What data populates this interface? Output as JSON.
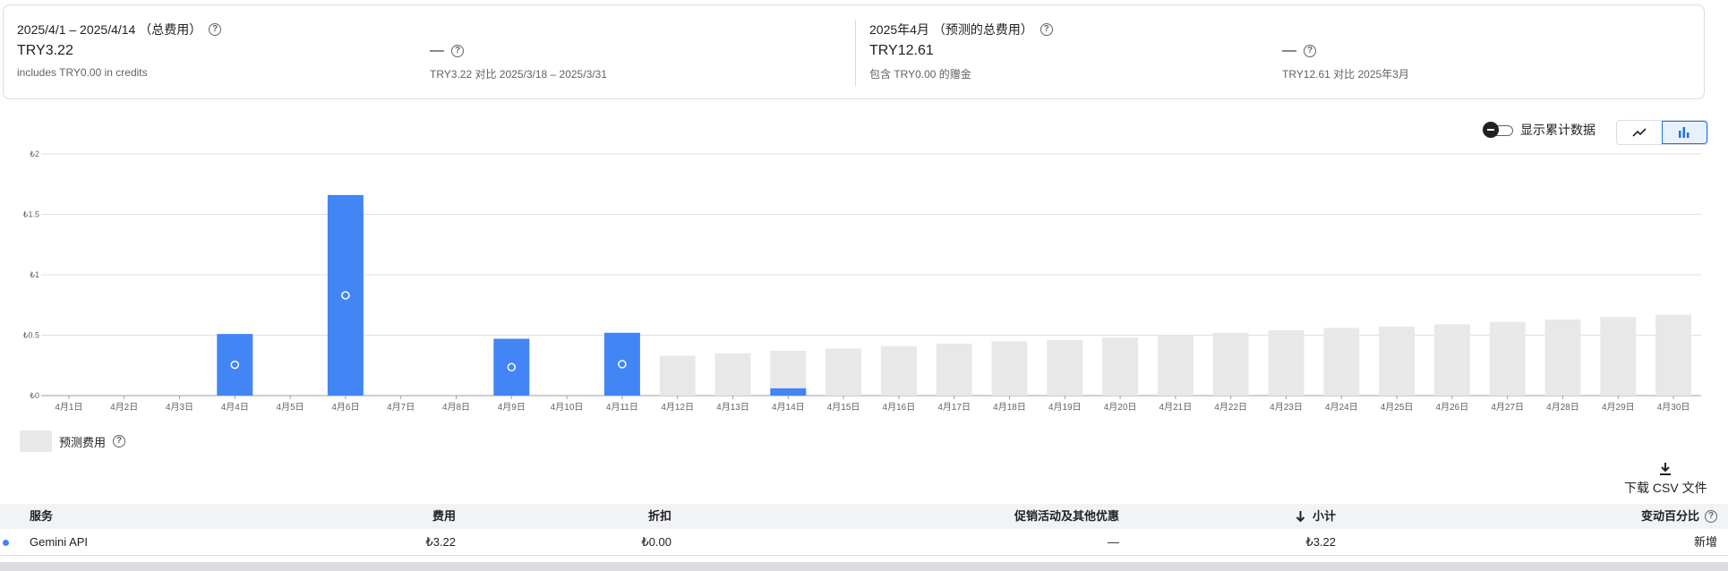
{
  "summary": {
    "left": {
      "title": "2025/4/1 – 2025/4/14 （总费用）",
      "value": "TRY3.22",
      "sub": "includes TRY0.00 in credits",
      "delta": "—",
      "delta_sub": "TRY3.22 对比 2025/3/18 – 2025/3/31"
    },
    "right": {
      "title": "2025年4月 （预测的总费用）",
      "value": "TRY12.61",
      "sub": "包含 TRY0.00 的赠金",
      "delta": "—",
      "delta_sub": "TRY12.61 对比 2025年3月"
    }
  },
  "controls": {
    "cumulative_label": "显示累计数据",
    "line_chart_icon": "line-chart-icon",
    "bar_chart_icon": "bar-chart-icon"
  },
  "chart_data": {
    "type": "bar",
    "categories": [
      "4月1日",
      "4月2日",
      "4月3日",
      "4月4日",
      "4月5日",
      "4月6日",
      "4月7日",
      "4月8日",
      "4月9日",
      "4月10日",
      "4月11日",
      "4月12日",
      "4月13日",
      "4月14日",
      "4月15日",
      "4月16日",
      "4月17日",
      "4月18日",
      "4月19日",
      "4月20日",
      "4月21日",
      "4月22日",
      "4月23日",
      "4月24日",
      "4月25日",
      "4月26日",
      "4月27日",
      "4月28日",
      "4月29日",
      "4月30日"
    ],
    "series": [
      {
        "name": "Gemini API",
        "values": [
          0,
          0,
          0,
          0.51,
          0,
          1.66,
          0,
          0,
          0.47,
          0,
          0.52,
          0,
          0,
          0.06,
          0,
          0,
          0,
          0,
          0,
          0,
          0,
          0,
          0,
          0,
          0,
          0,
          0,
          0,
          0,
          0
        ]
      },
      {
        "name": "预测费用",
        "values": [
          0,
          0,
          0,
          0,
          0,
          0,
          0,
          0,
          0,
          0,
          0,
          0.33,
          0.35,
          0.37,
          0.39,
          0.41,
          0.43,
          0.45,
          0.46,
          0.48,
          0.5,
          0.52,
          0.54,
          0.56,
          0.57,
          0.59,
          0.61,
          0.63,
          0.65,
          0.67
        ]
      }
    ],
    "yticks": [
      "₺0",
      "₺0.5",
      "₺1",
      "₺1.5",
      "₺2"
    ],
    "ylim": [
      0,
      2
    ],
    "colors": {
      "actual": "#4285f4",
      "forecast": "#e8e8e8"
    },
    "grid": true
  },
  "legend": {
    "forecast_label": "预测费用"
  },
  "download": {
    "label": "下载 CSV 文件"
  },
  "table": {
    "headers": {
      "service": "服务",
      "cost": "费用",
      "discount": "折扣",
      "promo": "促销活动及其他优惠",
      "subtotal": "小计",
      "change": "变动百分比"
    },
    "rows": [
      {
        "service": "Gemini API",
        "cost": "₺3.22",
        "discount": "₺0.00",
        "promo": "—",
        "subtotal": "₺3.22",
        "change": "新增"
      }
    ]
  }
}
